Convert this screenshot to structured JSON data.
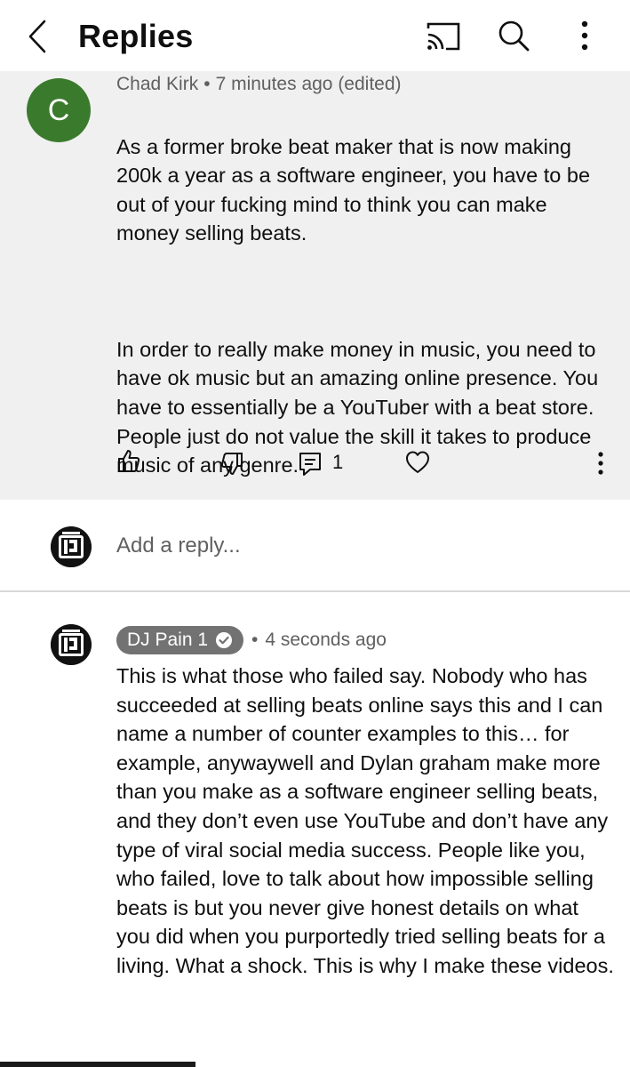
{
  "header": {
    "title": "Replies",
    "icons": [
      "chevron-left-icon",
      "cast-icon",
      "search-icon",
      "more-vertical-icon"
    ]
  },
  "parent_comment": {
    "avatar_letter": "C",
    "avatar_color": "#3a7a2c",
    "author": "Chad Kirk",
    "separator": "•",
    "timestamp": "7 minutes ago (edited)",
    "paragraph_1": "As a former broke beat maker that is now making 200k a year as a software engineer, you have to be out of your fucking mind to think you can make money selling beats.",
    "paragraph_2": "In order to really make money in music, you need to have ok music but an amazing online presence. You have to essentially be a YouTuber with a beat store. People just do not value the skill it takes to produce music of any genre.",
    "reply_count": "1"
  },
  "add_reply": {
    "placeholder": "Add a reply..."
  },
  "reply": {
    "author": "DJ Pain 1",
    "separator": "•",
    "timestamp": "4 seconds ago",
    "text": "This is what those who failed say. Nobody who has succeeded at selling beats online says this and I can name a number of counter examples to this… for example, anywaywell and Dylan graham make more than you make as a software engineer selling beats, and they don’t even use YouTube and don’t have any type of viral social media success. People like you, who failed, love to talk about how impossible selling beats is but you never give honest details on what you did when you purportedly tried selling beats for a living. What a shock. This is why I make these videos."
  },
  "colors": {
    "comment_bg": "#f0f0f0",
    "meta_gray": "#606060",
    "badge_gray": "#727272"
  }
}
